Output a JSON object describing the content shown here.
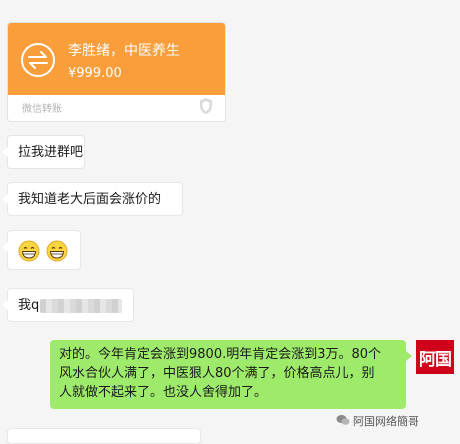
{
  "transfer": {
    "name": "李胜绪，中医养生",
    "amount": "¥999.00",
    "footer": "微信转账",
    "accent": "#fa9d3b"
  },
  "messages": [
    {
      "from": "other",
      "text": "拉我进群吧"
    },
    {
      "from": "other",
      "text": "我知道老大后面会涨价的"
    },
    {
      "from": "other",
      "emoji": [
        "grinning-emoji",
        "grinning-emoji"
      ]
    },
    {
      "from": "other",
      "text": "我q"
    },
    {
      "from": "me",
      "lines": [
        "对的。今年肯定会涨到9800.明年肯定会涨到3万。80个",
        "风水合伙人满了，中医狠人80个满了，价格高点儿，别",
        "人就做不起来了。也没人舍得加了。"
      ]
    }
  ],
  "avatar": {
    "text": "阿国",
    "color": "#d0021b"
  },
  "watermark": {
    "text": "阿国网络簡哥"
  },
  "colors": {
    "sent_bubble": "#9eea6a",
    "received_bubble": "#ffffff",
    "background": "#f5f5f5"
  }
}
